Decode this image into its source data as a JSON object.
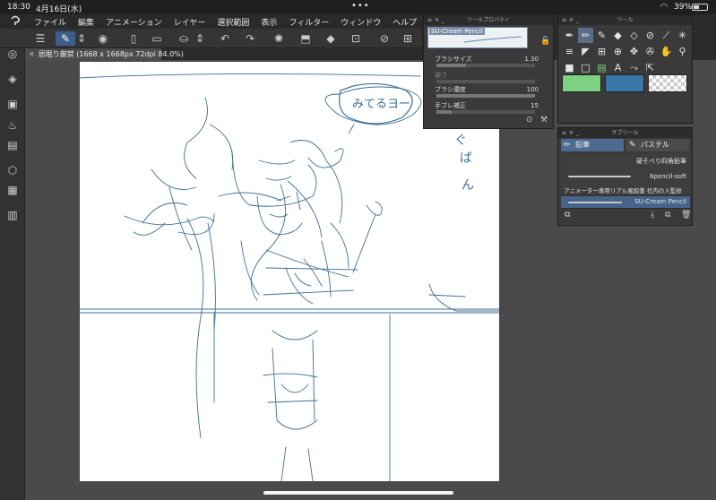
{
  "status": {
    "time": "18:30",
    "date": "4月16日(水)",
    "battery": "39%"
  },
  "menu": [
    "ファイル",
    "編集",
    "アニメーション",
    "レイヤー",
    "選択範囲",
    "表示",
    "フィルター",
    "ウィンドウ",
    "ヘルプ"
  ],
  "doc_tab": "居眠り厳禁 (1668 x 1668px 72dpi 84.0%)",
  "canvas_text": {
    "bubble": "みてるヨー",
    "vertical": [
      "ぐ",
      "ば",
      "ん"
    ]
  },
  "tool_property": {
    "title": "ツールプロパティ",
    "brush_name": "SU-Cream Pencil",
    "rows": [
      {
        "label": "ブラシサイズ",
        "value": "1.30",
        "fill": 0.3
      },
      {
        "label": "硬さ",
        "value": "",
        "fill": 0.0
      },
      {
        "label": "ブラシ濃度",
        "value": "100",
        "fill": 1.0
      },
      {
        "label": "手ブレ補正",
        "value": "15",
        "fill": 0.15
      }
    ]
  },
  "tool_panel": {
    "title": "ツール",
    "swatch_colors": [
      "#7ed083",
      "#3b76a8",
      "checker"
    ]
  },
  "sub_tool": {
    "title": "サブツール",
    "tabs": [
      "鉛筆",
      "パステル"
    ],
    "brushes": [
      {
        "name": "硬そべり四角鉛筆"
      },
      {
        "name": "6pencil-soft"
      },
      {
        "name": "アニメーター専用リアル風鉛筆 社内の人監修"
      },
      {
        "name": "SU-Cream Pencil"
      }
    ]
  },
  "colors": {
    "accent": "#4d6b90",
    "sketch": "#3d6f95",
    "main_color": "#7ed083",
    "sub_color": "#3b76a8"
  }
}
